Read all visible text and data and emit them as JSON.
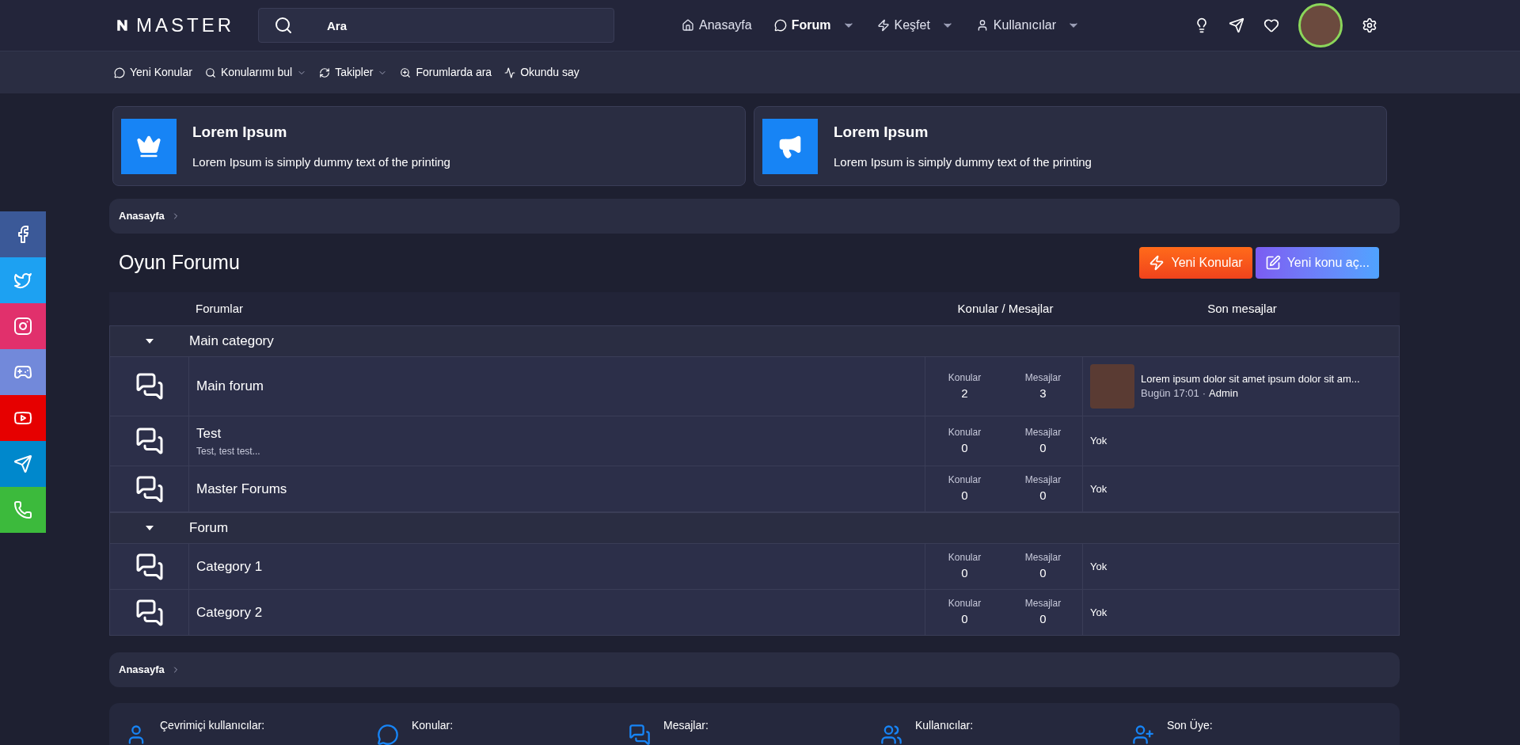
{
  "logo": {
    "text": "MASTER"
  },
  "search": {
    "placeholder": "Ara"
  },
  "nav": [
    {
      "label": "Anasayfa",
      "kind": "home",
      "selected": false,
      "dropdown": false
    },
    {
      "label": "Forum",
      "kind": "chat",
      "selected": true,
      "dropdown": true
    },
    {
      "label": "Keşfet",
      "kind": "bolt",
      "selected": false,
      "dropdown": true
    },
    {
      "label": "Kullanıcılar",
      "kind": "user",
      "selected": false,
      "dropdown": true
    }
  ],
  "subnav": [
    {
      "label": "Yeni Konular",
      "kind": "chat",
      "dropdown": false
    },
    {
      "label": "Konularımı bul",
      "kind": "search",
      "dropdown": true
    },
    {
      "label": "Takipler",
      "kind": "refresh",
      "dropdown": true
    },
    {
      "label": "Forumlarda ara",
      "kind": "zoom",
      "dropdown": false
    },
    {
      "label": "Okundu say",
      "kind": "check",
      "dropdown": false
    }
  ],
  "notices": [
    {
      "kind": "crown",
      "title": "Lorem Ipsum",
      "text": "Lorem Ipsum is simply dummy text of the printing"
    },
    {
      "kind": "megaphone",
      "title": "Lorem Ipsum",
      "text": "Lorem Ipsum is simply dummy text of the printing"
    }
  ],
  "breadcrumb_top": "Anasayfa",
  "page_title": "Oyun Forumu",
  "buttons": [
    {
      "kind": "orange",
      "label": "Yeni Konular"
    },
    {
      "kind": "blue",
      "label": "Yeni konu aç..."
    }
  ],
  "table": {
    "columns": [
      "Forumlar",
      "Konular / Mesajlar",
      "Son mesajlar"
    ],
    "categories": [
      {
        "title": "Main category",
        "expanded": true,
        "forums": [
          {
            "title": "Main forum",
            "konular_label": "Konular",
            "konular": "2",
            "mesajlar_label": "Mesajlar",
            "mesajlar": "3",
            "last": {
              "title": "Lorem ipsum dolor sit amet ipsum dolor sit am...",
              "date": "Bugün 17:01",
              "separator": "·",
              "user": "Admin"
            }
          },
          {
            "title": "Test",
            "description": "Test, test test...",
            "konular_label": "Konular",
            "konular": "0",
            "mesajlar_label": "Mesajlar",
            "mesajlar": "0",
            "none": "Yok"
          },
          {
            "title": "Master Forums",
            "konular_label": "Konular",
            "konular": "0",
            "mesajlar_label": "Mesajlar",
            "mesajlar": "0",
            "none": "Yok"
          }
        ]
      },
      {
        "title": "Forum",
        "expanded": true,
        "forums": [
          {
            "title": "Category 1",
            "konular_label": "Konular",
            "konular": "0",
            "mesajlar_label": "Mesajlar",
            "mesajlar": "0",
            "none": "Yok"
          },
          {
            "title": "Category 2",
            "konular_label": "Konular",
            "konular": "0",
            "mesajlar_label": "Mesajlar",
            "mesajlar": "0",
            "none": "Yok"
          }
        ]
      }
    ]
  },
  "breadcrumb_bottom": "Anasayfa",
  "stats": [
    {
      "kind": "user",
      "label": "Çevrimiçi kullanıcılar:"
    },
    {
      "kind": "chat",
      "label": "Konular:"
    },
    {
      "kind": "chats",
      "label": "Mesajlar:"
    },
    {
      "kind": "users",
      "label": "Kullanıcılar:"
    },
    {
      "kind": "userplus",
      "label": "Son Üye:"
    }
  ],
  "social": [
    {
      "kind": "facebook",
      "color": "#3b5998"
    },
    {
      "kind": "twitter",
      "color": "#1da1f2"
    },
    {
      "kind": "instagram",
      "color": "#e1306c"
    },
    {
      "kind": "discord",
      "color": "#7289da"
    },
    {
      "kind": "youtube",
      "color": "#e60000"
    },
    {
      "kind": "telegram",
      "color": "#0088cc"
    },
    {
      "kind": "whatsapp",
      "color": "#3cba3c"
    }
  ]
}
